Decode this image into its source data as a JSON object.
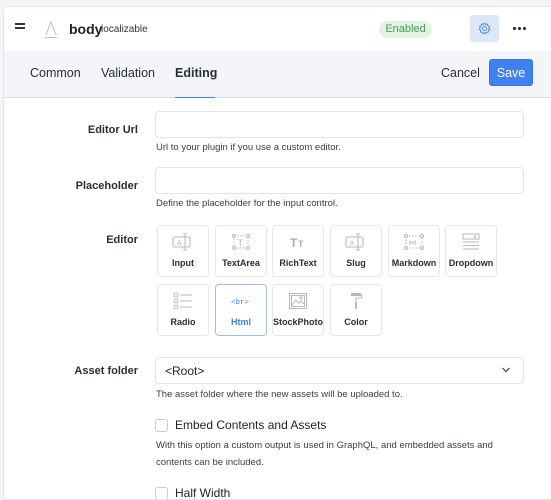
{
  "header": {
    "field_name": "body",
    "field_tag": "localizable",
    "status_badge": "Enabled",
    "type_icon": "string-field-icon",
    "settings_icon": "gear-icon",
    "more_icon": "more-horizontal-icon",
    "drag_icon": "drag-handle-icon"
  },
  "tabs": [
    {
      "label": "Common",
      "active": false
    },
    {
      "label": "Validation",
      "active": false
    },
    {
      "label": "Editing",
      "active": true
    }
  ],
  "actions": {
    "cancel": "Cancel",
    "save": "Save"
  },
  "colors": {
    "accent": "#3f82ef",
    "badge_bg": "#e2f3e3",
    "badge_text": "#4c9a54",
    "tab_bar_bg": "#f4f5f8"
  },
  "form": {
    "editor_url": {
      "label": "Editor Url",
      "value": "",
      "hint": "Url to your plugin if you use a custom editor."
    },
    "placeholder": {
      "label": "Placeholder",
      "value": "",
      "hint": "Define the placeholder for the input control."
    },
    "editor": {
      "label": "Editor",
      "selected": "Html",
      "options": [
        {
          "name": "Input",
          "icon": "input-icon"
        },
        {
          "name": "TextArea",
          "icon": "textarea-icon"
        },
        {
          "name": "RichText",
          "icon": "richtext-icon"
        },
        {
          "name": "Slug",
          "icon": "slug-icon"
        },
        {
          "name": "Markdown",
          "icon": "markdown-icon"
        },
        {
          "name": "Dropdown",
          "icon": "dropdown-icon"
        },
        {
          "name": "Radio",
          "icon": "radio-icon"
        },
        {
          "name": "Html",
          "icon": "html-icon"
        },
        {
          "name": "StockPhoto",
          "icon": "stock-photo-icon"
        },
        {
          "name": "Color",
          "icon": "color-icon"
        }
      ]
    },
    "asset_folder": {
      "label": "Asset folder",
      "value": "<Root>",
      "hint": "The asset folder where the new assets will be uploaded to."
    },
    "embed": {
      "label": "Embed Contents and Assets",
      "checked": false,
      "hint_line1": "With this option a custom output is used in GraphQL, and embedded assets and",
      "hint_line2": "contents can be included."
    },
    "half_width": {
      "label": "Half Width",
      "checked": false
    }
  }
}
